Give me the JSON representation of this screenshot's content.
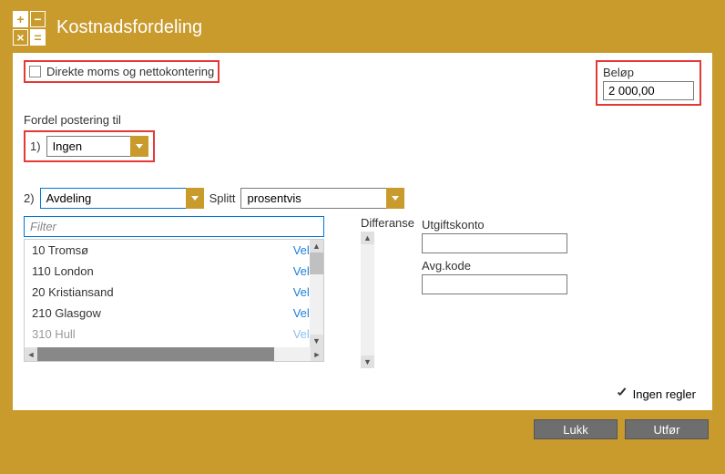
{
  "header": {
    "title": "Kostnadsfordeling"
  },
  "direkte": {
    "label": "Direkte moms og nettokontering",
    "checked": false
  },
  "belop": {
    "label": "Beløp",
    "value": "2 000,00"
  },
  "fordel_label": "Fordel postering til",
  "row1": {
    "index": "1)",
    "value": "Ingen"
  },
  "row2": {
    "index": "2)",
    "value": "Avdeling",
    "splitt_label": "Splitt",
    "splitt_value": "prosentvis"
  },
  "filter_placeholder": "Filter",
  "list": [
    {
      "name": "10 Tromsø",
      "action": "Velg"
    },
    {
      "name": "110 London",
      "action": "Velg"
    },
    {
      "name": "20 Kristiansand",
      "action": "Velg"
    },
    {
      "name": "210 Glasgow",
      "action": "Velg"
    },
    {
      "name": "310 Hull",
      "action": "Velg"
    }
  ],
  "differanse_label": "Differanse",
  "utgiftskonto_label": "Utgiftskonto",
  "avgkode_label": "Avg.kode",
  "ingen_regler": "Ingen regler",
  "buttons": {
    "lukk": "Lukk",
    "utfor": "Utfør"
  }
}
